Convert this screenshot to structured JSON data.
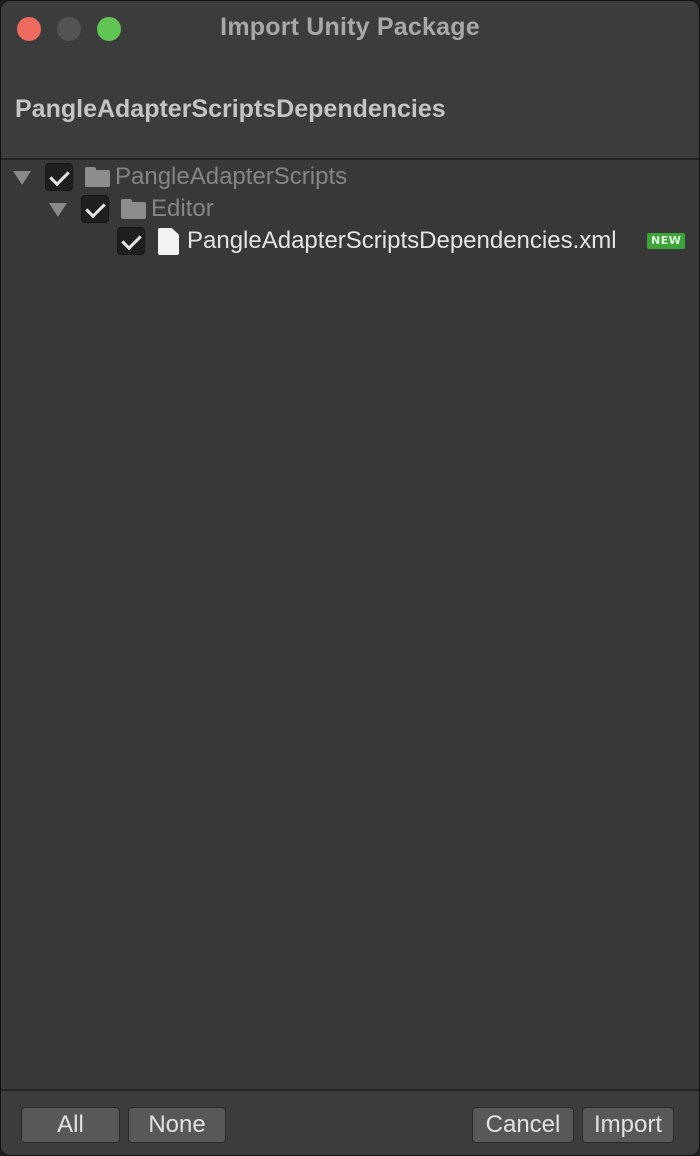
{
  "window": {
    "title": "Import Unity Package"
  },
  "header": {
    "package_name": "PangleAdapterScriptsDependencies"
  },
  "tree": {
    "items": [
      {
        "label": "PangleAdapterScripts",
        "type": "folder",
        "checked": true,
        "expanded": true,
        "icon": "folder-icon"
      },
      {
        "label": "Editor",
        "type": "folder",
        "checked": true,
        "expanded": true,
        "icon": "folder-icon"
      },
      {
        "label": "PangleAdapterScriptsDependencies.xml",
        "type": "file",
        "checked": true,
        "icon": "file-icon",
        "badge": "NEW"
      }
    ]
  },
  "footer": {
    "all_label": "All",
    "none_label": "None",
    "cancel_label": "Cancel",
    "import_label": "Import"
  },
  "colors": {
    "close": "#ed6a5e",
    "minimize": "#545454",
    "maximize": "#61c554",
    "new_badge": "#3da43a",
    "background": "#383838"
  }
}
